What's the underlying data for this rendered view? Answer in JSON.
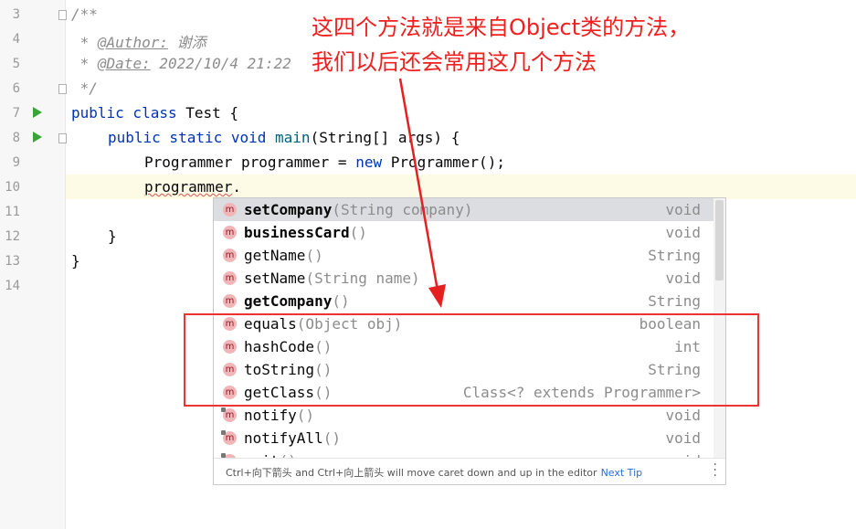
{
  "editor": {
    "line_numbers": [
      "3",
      "4",
      "5",
      "6",
      "7",
      "8",
      "9",
      "10",
      "11",
      "12",
      "13",
      "14"
    ],
    "lines": {
      "l3": "/**",
      "l4_prefix": " * ",
      "l4_tag": "@Author:",
      "l4_value": " 谢添",
      "l5_prefix": " * ",
      "l5_tag": "@Date:",
      "l5_value": " 2022/10/4 21:22",
      "l6": " */",
      "l7_kw": "public class",
      "l7_rest": " Test {",
      "l8_kw": "public static void",
      "l8_fn": " main",
      "l8_rest": "(String[] args) {",
      "l9_a": "Programmer programmer = ",
      "l9_kw": "new",
      "l9_b": " Programmer();",
      "l10_a": "programmer",
      "l10_b": ".",
      "l12": "}",
      "l13": "}"
    }
  },
  "completion": {
    "icon_letter": "m",
    "items": [
      {
        "name": "setCompany",
        "params": "(String company)",
        "type": "void",
        "bold": true
      },
      {
        "name": "businessCard",
        "params": "()",
        "type": "void",
        "bold": true
      },
      {
        "name": "getName",
        "params": "()",
        "type": "String",
        "bold": false
      },
      {
        "name": "setName",
        "params": "(String name)",
        "type": "void",
        "bold": false
      },
      {
        "name": "getCompany",
        "params": "()",
        "type": "String",
        "bold": true
      },
      {
        "name": "equals",
        "params": "(Object obj)",
        "type": "boolean",
        "bold": false
      },
      {
        "name": "hashCode",
        "params": "()",
        "type": "int",
        "bold": false
      },
      {
        "name": "toString",
        "params": "()",
        "type": "String",
        "bold": false
      },
      {
        "name": "getClass",
        "params": "()",
        "type": "Class<? extends Programmer>",
        "bold": false
      },
      {
        "name": "notify",
        "params": "()",
        "type": "void",
        "bold": false
      },
      {
        "name": "notifyAll",
        "params": "()",
        "type": "void",
        "bold": false
      },
      {
        "name": "wait",
        "params": "()",
        "type": "void",
        "bold": false
      }
    ],
    "footer_text": "Ctrl+向下箭头 and Ctrl+向上箭头 will move caret down and up in the editor",
    "footer_link": "Next Tip"
  },
  "annotation": {
    "line1": "这四个方法就是来自Object类的方法，",
    "line2": "我们以后还会常用这几个方法"
  }
}
